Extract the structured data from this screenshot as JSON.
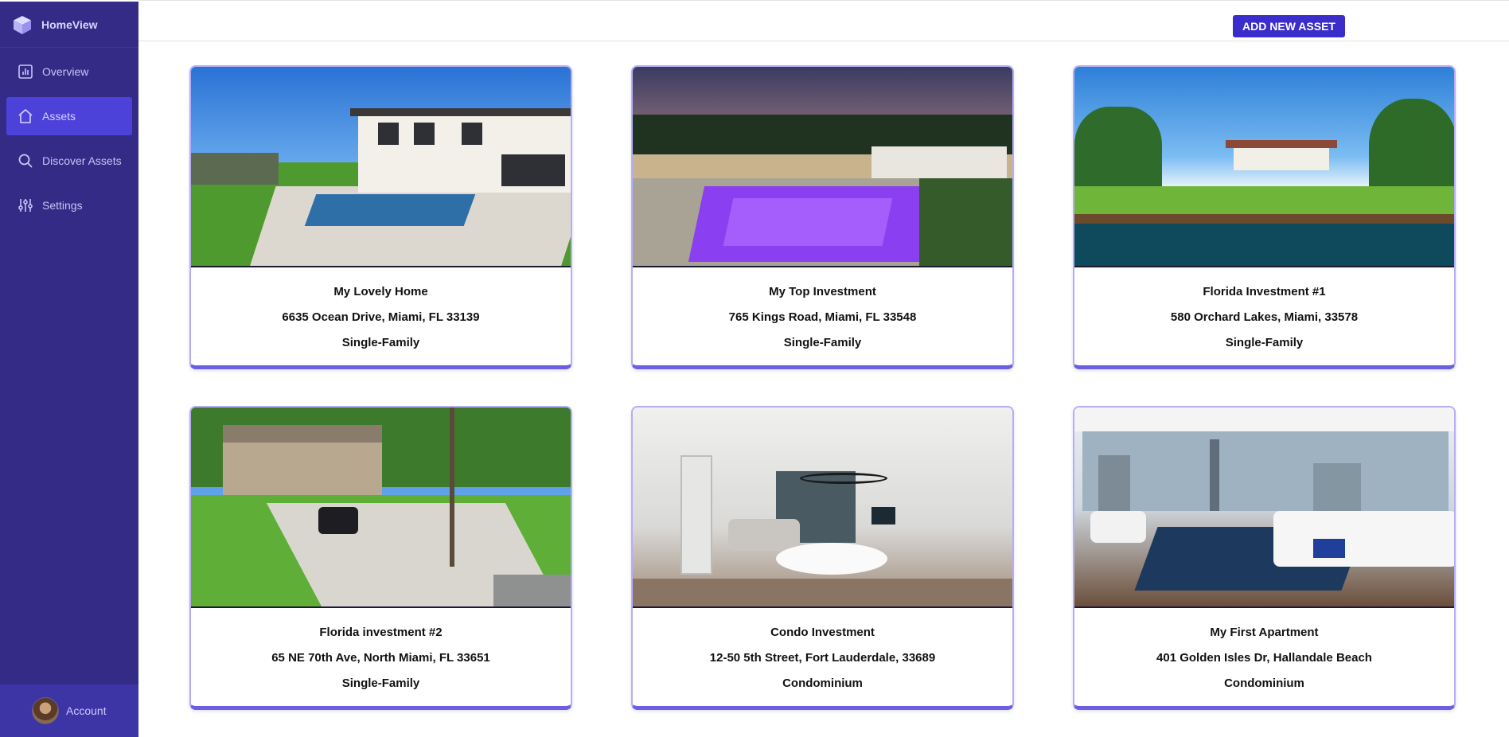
{
  "app": {
    "name": "HomeView"
  },
  "sidebar": {
    "items": [
      {
        "label": "Overview",
        "icon": "chart-icon",
        "active": false
      },
      {
        "label": "Assets",
        "icon": "home-icon",
        "active": true
      },
      {
        "label": "Discover Assets",
        "icon": "search-icon",
        "active": false
      },
      {
        "label": "Settings",
        "icon": "sliders-icon",
        "active": false
      }
    ],
    "account_label": "Account"
  },
  "toolbar": {
    "add_label": "ADD NEW ASSET"
  },
  "assets": [
    {
      "title": "My Lovely Home",
      "address": "6635 Ocean Drive, Miami, FL 33139",
      "type": "Single-Family"
    },
    {
      "title": "My Top Investment",
      "address": "765 Kings Road, Miami, FL 33548",
      "type": "Single-Family"
    },
    {
      "title": "Florida Investment #1",
      "address": "580 Orchard Lakes, Miami, 33578",
      "type": "Single-Family"
    },
    {
      "title": "Florida investment #2",
      "address": "65 NE 70th Ave, North Miami, FL 33651",
      "type": "Single-Family"
    },
    {
      "title": "Condo Investment",
      "address": "12-50 5th Street, Fort Lauderdale, 33689",
      "type": "Condominium"
    },
    {
      "title": "My First Apartment",
      "address": "401 Golden Isles Dr, Hallandale Beach",
      "type": "Condominium"
    }
  ],
  "colors": {
    "sidebar_bg": "#332b85",
    "active_item": "#4c42d9",
    "accent_button": "#3b2ccc",
    "card_border": "#b5aef5",
    "card_bottom": "#6a5fe0"
  }
}
